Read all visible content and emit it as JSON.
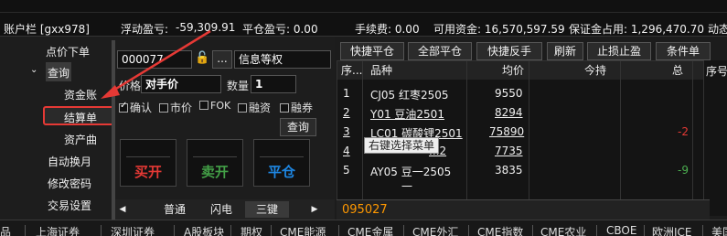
{
  "status": {
    "account_label": "账户栏 [gxx978]",
    "float_pnl_label": "浮动盈亏:",
    "float_pnl_value": "-59,309.91",
    "close_pnl": "平仓盈亏: 0.00",
    "fee": "手续费: 0.00",
    "available": "可用资金: 16,570,597.59",
    "margin": "保证金占用: 1,296,470.70",
    "dynamic": "动态权益"
  },
  "nav": {
    "items": [
      "点价下单",
      "查询",
      "资金账",
      "结算单",
      "资产曲",
      "自动换月",
      "修改密码",
      "交易设置"
    ],
    "expand_icon": "chevron-down-icon"
  },
  "order": {
    "account_value": "000077",
    "ellipsis": "...",
    "info_label": "信息等权",
    "price_label": "价格",
    "price_value": "对手价",
    "qty_label": "数量",
    "qty_value": "1",
    "confirm": "确认",
    "market": "市价",
    "fok": "FOK",
    "financing": "融资",
    "securities": "融券",
    "query_button": "查询",
    "buy_open": "买开",
    "sell_open": "卖开",
    "close": "平仓"
  },
  "toolbar": {
    "quick_close": "快捷平仓",
    "close_all": "全部平仓",
    "quick_reverse": "快捷反手",
    "refresh": "刷新",
    "stop": "止损止盈",
    "conditional": "条件单"
  },
  "grid": {
    "headers": [
      "序...",
      "品种",
      "均价",
      "今持",
      "总"
    ],
    "right_header": "序号",
    "rows": [
      {
        "no": "1",
        "name": "CJ05 红枣2505",
        "avg": "9550",
        "pnl": "",
        "pnl_color": ""
      },
      {
        "no": "2",
        "name": "Y01 豆油2501",
        "avg": "8294",
        "pnl": "",
        "pnl_color": ""
      },
      {
        "no": "3",
        "name": "LC01 碳酸锂2501",
        "avg": "75890",
        "pnl": "-2",
        "pnl_color": "#e53935"
      },
      {
        "no": "4",
        "name": "...2",
        "avg": "7735",
        "pnl": "",
        "pnl_color": ""
      },
      {
        "no": "5",
        "name": "AY05 豆一2505",
        "avg": "3835",
        "pnl": "-9",
        "pnl_color": "#4caf50"
      }
    ],
    "extra_row": "一",
    "tooltip": "右键选择菜单"
  },
  "subtabs": [
    "普通",
    "闪电",
    "三键"
  ],
  "code": "095027",
  "bottom_tabs": [
    "品",
    "上海证券",
    "深圳证券",
    "A股板块",
    "期权",
    "CME能源",
    "CME金属",
    "CME外汇",
    "CME指数",
    "CME农业",
    "CBOE",
    "欧洲ICE",
    "美国"
  ],
  "colors": {
    "buy": "#e53935",
    "sell": "#43a047",
    "close": "#1e88e5",
    "accent": "#e53935",
    "lock": "#2e7d32",
    "code": "#ff9800"
  }
}
